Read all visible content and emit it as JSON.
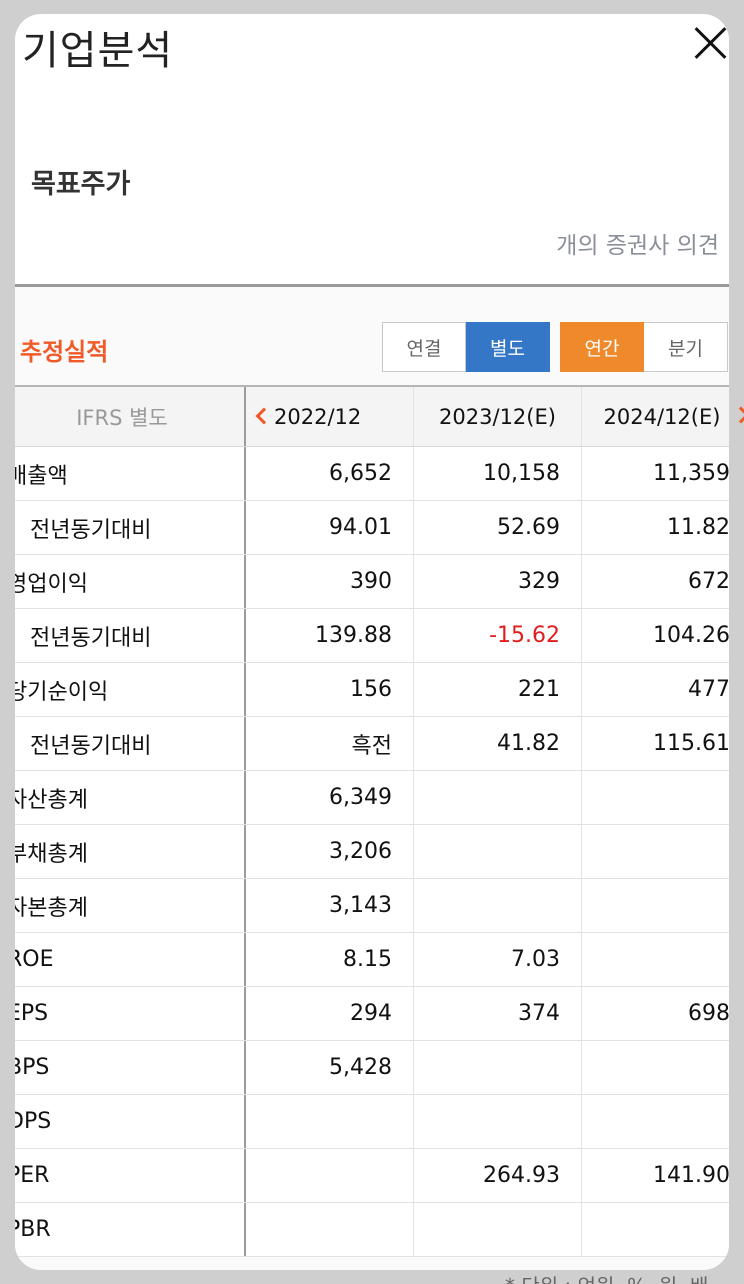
{
  "modal": {
    "title": "기업분석",
    "close_icon": "close-icon"
  },
  "target_price": {
    "label": "목표주가",
    "opinion_text": "개의 증권사 의견"
  },
  "estimates": {
    "title": "추정실적",
    "basis_toggle": [
      "연결",
      "별도"
    ],
    "basis_selected": "별도",
    "period_toggle": [
      "연간",
      "분기"
    ],
    "period_selected": "연간"
  },
  "table": {
    "header": {
      "label": "IFRS 별도",
      "cols": [
        "2022/12",
        "2023/12(E)",
        "2024/12(E)"
      ]
    },
    "rows": [
      {
        "label": "매출액",
        "sub": false,
        "values": [
          "6,652",
          "10,158",
          "11,359"
        ]
      },
      {
        "label": "전년동기대비",
        "sub": true,
        "values": [
          "94.01",
          "52.69",
          "11.82"
        ]
      },
      {
        "label": "영업이익",
        "sub": false,
        "values": [
          "390",
          "329",
          "672"
        ]
      },
      {
        "label": "전년동기대비",
        "sub": true,
        "values": [
          "139.88",
          "-15.62",
          "104.26"
        ]
      },
      {
        "label": "당기순이익",
        "sub": false,
        "values": [
          "156",
          "221",
          "477"
        ]
      },
      {
        "label": "전년동기대비",
        "sub": true,
        "values": [
          "흑전",
          "41.82",
          "115.61"
        ]
      },
      {
        "label": "자산총계",
        "sub": false,
        "values": [
          "6,349",
          "",
          ""
        ]
      },
      {
        "label": "부채총계",
        "sub": false,
        "values": [
          "3,206",
          "",
          ""
        ]
      },
      {
        "label": "자본총계",
        "sub": false,
        "values": [
          "3,143",
          "",
          ""
        ]
      },
      {
        "label": "ROE",
        "sub": false,
        "values": [
          "8.15",
          "7.03",
          ""
        ]
      },
      {
        "label": "EPS",
        "sub": false,
        "values": [
          "294",
          "374",
          "698"
        ]
      },
      {
        "label": "BPS",
        "sub": false,
        "values": [
          "5,428",
          "",
          ""
        ]
      },
      {
        "label": "DPS",
        "sub": false,
        "values": [
          "",
          "",
          ""
        ]
      },
      {
        "label": "PER",
        "sub": false,
        "values": [
          "",
          "264.93",
          "141.90"
        ]
      },
      {
        "label": "PBR",
        "sub": false,
        "values": [
          "",
          "",
          ""
        ]
      }
    ]
  },
  "footer": {
    "note": "* 단위 : 억원, %, 원, 배"
  },
  "colors": {
    "accent_orange": "#f05a28",
    "toggle_blue": "#3477c6",
    "toggle_orange": "#ee8a2b",
    "negative_red": "#e01e1e"
  }
}
